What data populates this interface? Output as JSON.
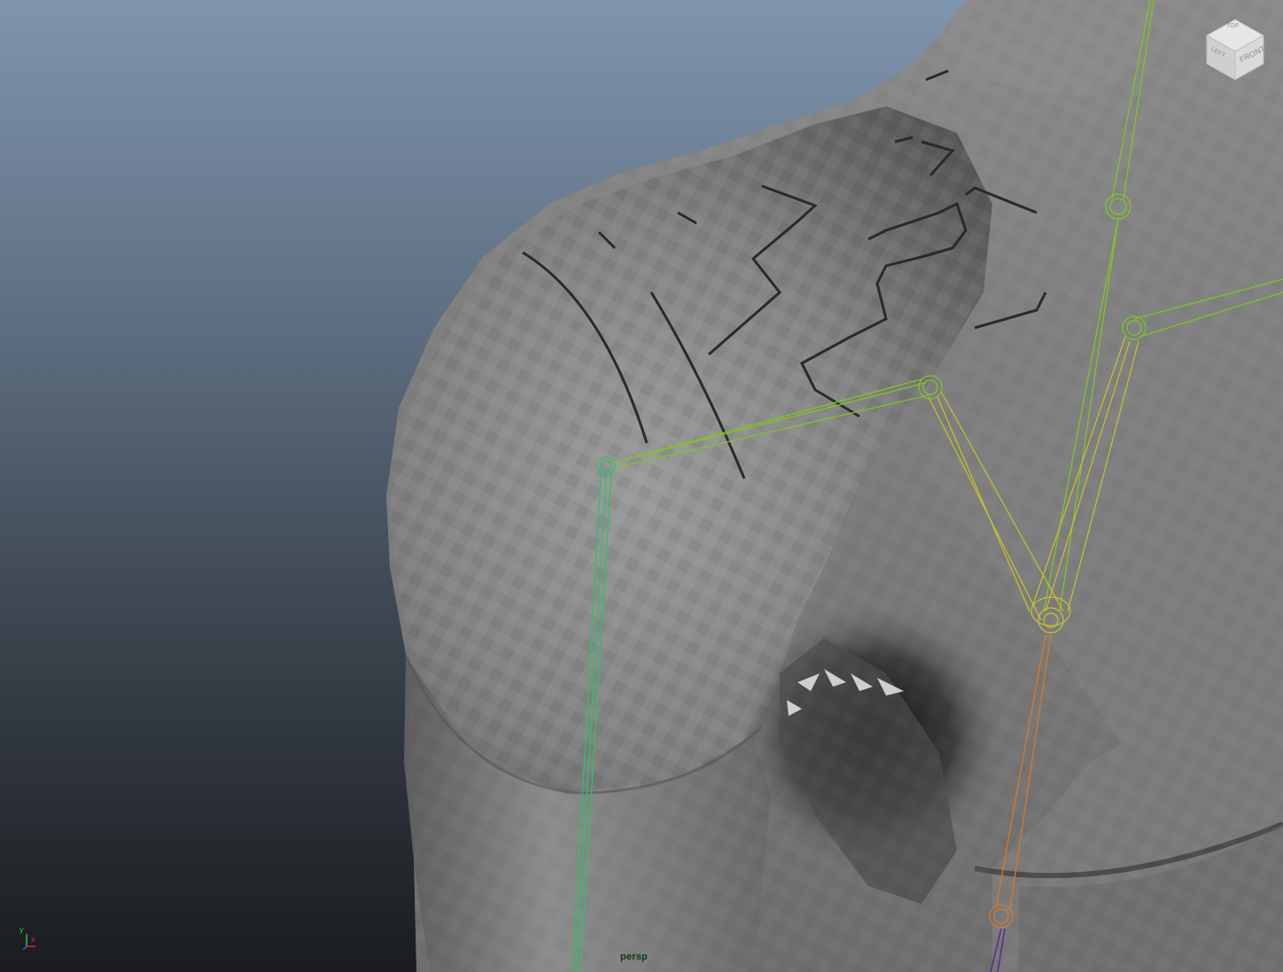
{
  "viewport": {
    "camera_name": "persp",
    "view_cube": {
      "top": "TOP",
      "left": "LEFT",
      "front": "FRONT"
    },
    "axis_gizmo": {
      "y": "y",
      "x": "x"
    }
  },
  "colors": {
    "mesh": "#7e7e7e",
    "joint_green": "#7fc428",
    "joint_yellow": "#c9c22a",
    "joint_teal": "#2fbf6b",
    "joint_orange": "#d67a2a",
    "joint_purple": "#5a2a8c",
    "camera_label": "#0f3a1a"
  },
  "icons": [
    "view-cube-icon",
    "axis-gizmo-icon"
  ]
}
